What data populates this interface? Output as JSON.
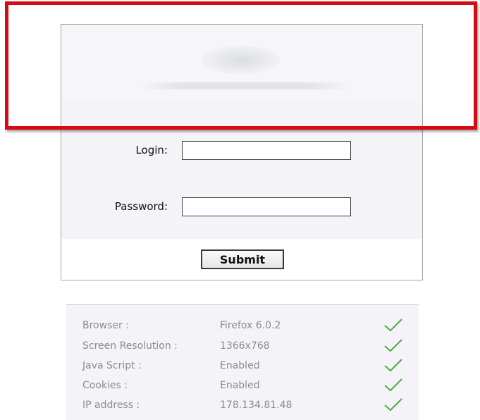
{
  "login_form": {
    "login_label": "Login:",
    "login_value": "",
    "password_label": "Password:",
    "password_value": "",
    "submit_label": "Submit"
  },
  "system_info": {
    "rows": [
      {
        "key": "Browser :",
        "value": "Firefox 6.0.2",
        "status_icon": "check-icon"
      },
      {
        "key": "Screen Resolution :",
        "value": "1366x768",
        "status_icon": "check-icon"
      },
      {
        "key": "Java Script :",
        "value": "Enabled",
        "status_icon": "check-icon"
      },
      {
        "key": "Cookies :",
        "value": "Enabled",
        "status_icon": "check-icon"
      },
      {
        "key": "IP address :",
        "value": "178.134.81.48",
        "status_icon": "check-icon"
      }
    ]
  },
  "colors": {
    "highlight_border": "#d40b12",
    "check_green": "#4cae3c",
    "panel_bg": "#f3f3f8",
    "info_text": "#8d8d8d"
  }
}
